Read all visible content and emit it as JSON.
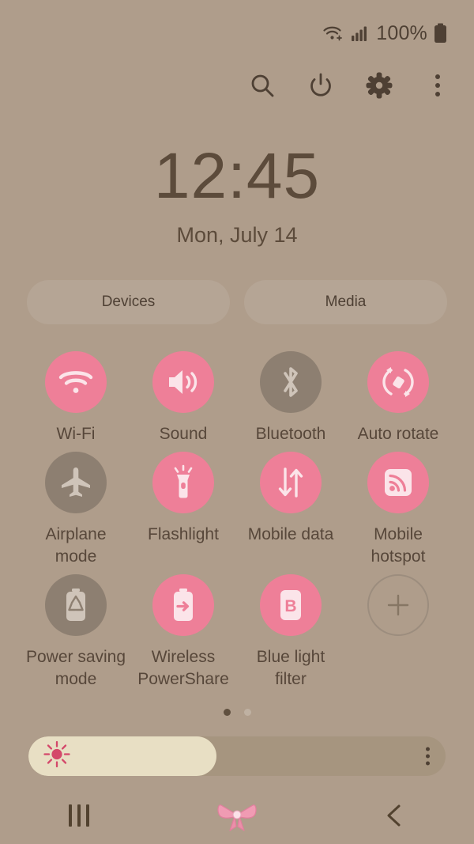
{
  "statusbar": {
    "wifi_icon": "wifi-plus-icon",
    "signal_icon": "cellular-signal-icon",
    "battery_text": "100%",
    "battery_icon": "battery-full-icon"
  },
  "quick_header": {
    "search_label": "search-icon",
    "power_label": "power-icon",
    "settings_label": "gear-icon",
    "more_label": "more-options-icon"
  },
  "clock": {
    "time": "12:45",
    "date": "Mon, July 14"
  },
  "pills": [
    {
      "label": "Devices"
    },
    {
      "label": "Media"
    }
  ],
  "toggles": [
    {
      "label": "Wi-Fi",
      "state": "on",
      "icon": "wifi-icon"
    },
    {
      "label": "Sound",
      "state": "on",
      "icon": "sound-icon"
    },
    {
      "label": "Bluetooth",
      "state": "off",
      "icon": "bluetooth-icon"
    },
    {
      "label": "Auto rotate",
      "state": "on",
      "icon": "auto-rotate-icon"
    },
    {
      "label": "Airplane mode",
      "state": "off",
      "icon": "airplane-icon"
    },
    {
      "label": "Flashlight",
      "state": "on",
      "icon": "flashlight-icon"
    },
    {
      "label": "Mobile data",
      "state": "on",
      "icon": "mobile-data-icon"
    },
    {
      "label": "Mobile hotspot",
      "state": "on",
      "icon": "hotspot-icon"
    },
    {
      "label": "Power saving mode",
      "state": "off",
      "icon": "power-saving-icon"
    },
    {
      "label": "Wireless PowerShare",
      "state": "on",
      "icon": "wireless-powershare-icon"
    },
    {
      "label": "Blue light filter",
      "state": "on",
      "icon": "blue-light-filter-icon"
    },
    {
      "label": "",
      "state": "add",
      "icon": "add-icon"
    }
  ],
  "page_indicator": {
    "total": 2,
    "active": 1
  },
  "brightness": {
    "value_percent": 45,
    "sun_icon": "brightness-sun-icon",
    "menu_icon": "brightness-options-icon"
  },
  "navbar": {
    "recents_label": "recents-icon",
    "home_label": "home-bow-icon",
    "back_label": "back-icon"
  },
  "colors": {
    "background": "#af9d8b",
    "accent_on": "#ee7f98",
    "toggle_off": "#8d7f71",
    "text": "#57473a",
    "slider_fill": "#e8dfc4"
  }
}
